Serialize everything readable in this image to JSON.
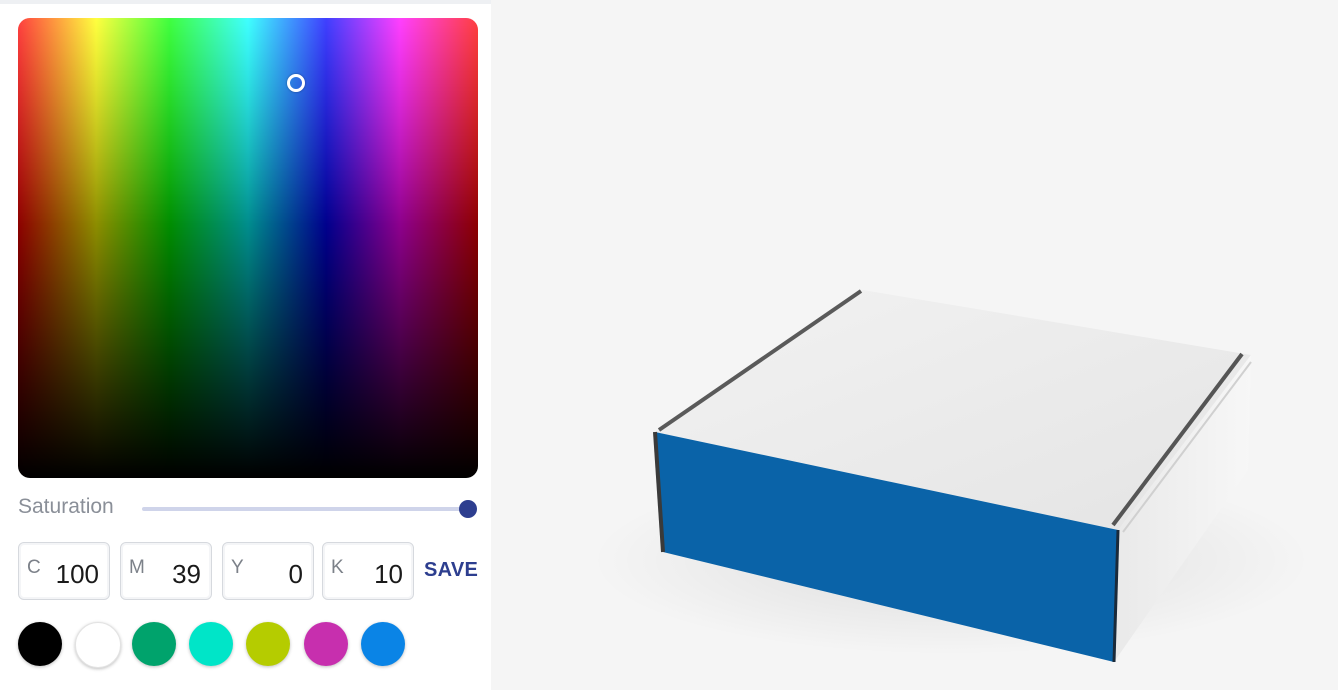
{
  "saturation": {
    "label": "Saturation",
    "value_fraction": 1.0
  },
  "cmyk": {
    "c": {
      "letter": "C",
      "value": "100"
    },
    "m": {
      "letter": "M",
      "value": "39"
    },
    "y": {
      "letter": "Y",
      "value": "0"
    },
    "k": {
      "letter": "K",
      "value": "10"
    }
  },
  "save_label": "SAVE",
  "swatches": [
    {
      "name": "black",
      "color": "#000000"
    },
    {
      "name": "white",
      "color": "#ffffff"
    },
    {
      "name": "green",
      "color": "#00a36c"
    },
    {
      "name": "aqua",
      "color": "#00e5c8"
    },
    {
      "name": "lime",
      "color": "#b5cc00"
    },
    {
      "name": "magenta",
      "color": "#c72fae"
    },
    {
      "name": "blue",
      "color": "#0a84e6"
    }
  ],
  "accent_color": "#2d3e8f",
  "box_front_color": "#0a63a8",
  "preview_object": "mailer-box"
}
